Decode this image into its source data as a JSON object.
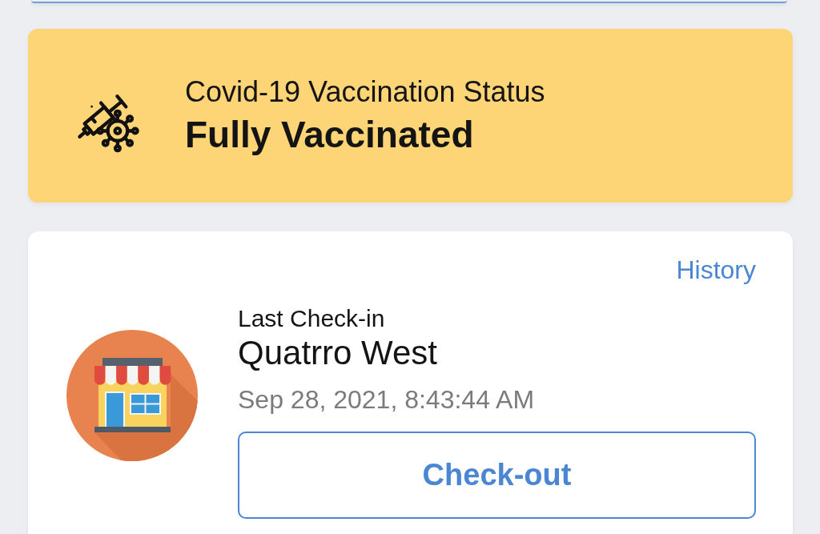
{
  "vaccination_status": {
    "title": "Covid-19 Vaccination Status",
    "status": "Fully Vaccinated"
  },
  "check_in": {
    "history_link": "History",
    "label": "Last Check-in",
    "place": "Quatrro West",
    "time": "Sep 28, 2021, 8:43:44 AM",
    "button": "Check-out"
  }
}
